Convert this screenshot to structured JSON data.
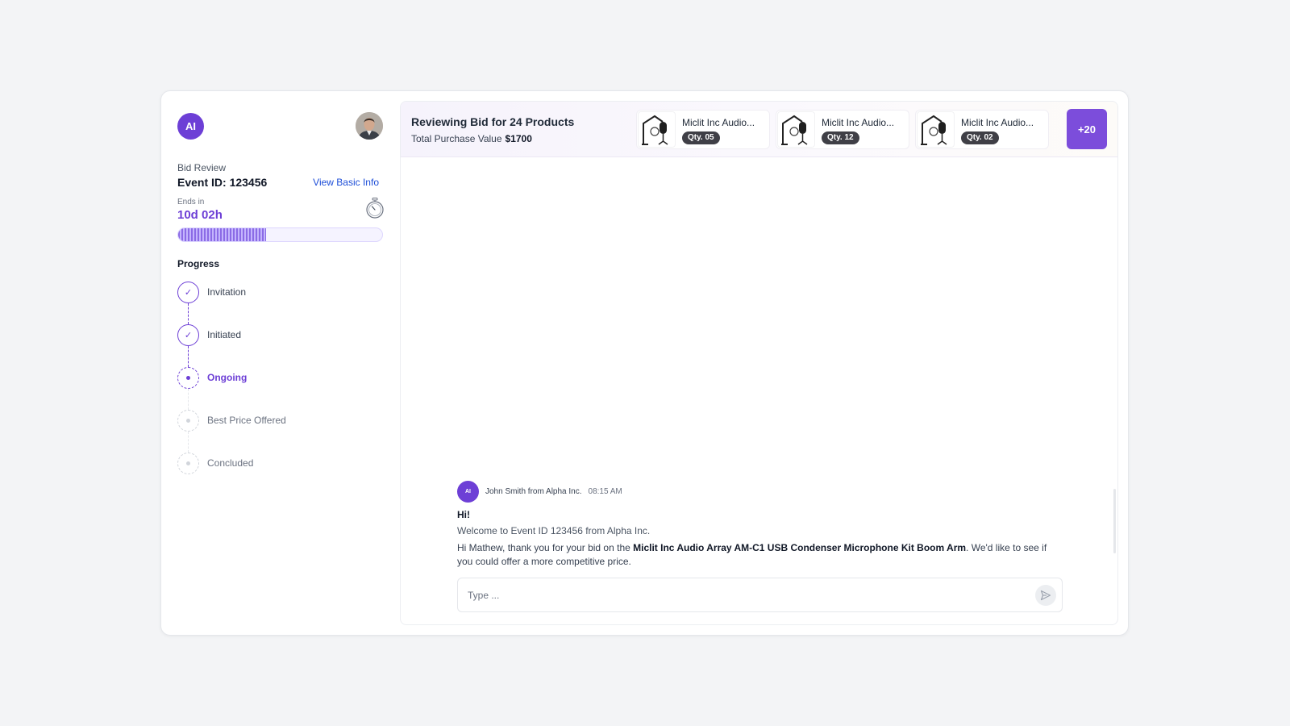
{
  "sidebar": {
    "logo_text": "AI",
    "subtitle": "Bid Review",
    "event_label": "Event ID: 123456",
    "view_link": "View Basic Info",
    "ends_label": "Ends in",
    "ends_value": "10d 02h",
    "time_progress_percent": 43,
    "progress_title": "Progress",
    "steps": [
      {
        "label": "Invitation",
        "status": "done"
      },
      {
        "label": "Initiated",
        "status": "done"
      },
      {
        "label": "Ongoing",
        "status": "current"
      },
      {
        "label": "Best Price Offered",
        "status": "pending"
      },
      {
        "label": "Concluded",
        "status": "pending"
      }
    ]
  },
  "header": {
    "title": "Reviewing Bid for 24 Products",
    "subtitle_label": "Total Purchase Value",
    "subtitle_value": "$1700",
    "products": [
      {
        "name": "Miclit Inc Audio...",
        "qty": "Qty. 05"
      },
      {
        "name": "Miclit Inc Audio...",
        "qty": "Qty. 12"
      },
      {
        "name": "Miclit Inc Audio...",
        "qty": "Qty. 02"
      }
    ],
    "more_label": "+20"
  },
  "message": {
    "avatar_text": "AI",
    "sender": "John Smith from Alpha Inc.",
    "time": "08:15 AM",
    "greeting": "Hi!",
    "welcome": "Welcome to Event ID 123456 from Alpha Inc.",
    "body_before": "Hi Mathew, thank you for your bid on the ",
    "body_product": "Miclit Inc Audio Array AM-C1 USB Condenser Microphone Kit Boom Arm",
    "body_after": ". We'd like to see if you could offer a more competitive price."
  },
  "composer": {
    "placeholder": "Type ..."
  },
  "colors": {
    "accent": "#6d3fd6",
    "link": "#1d4ed8",
    "more_button": "#7c4ddb"
  },
  "icons": [
    "stopwatch-icon",
    "check-icon",
    "microphone-icon",
    "send-icon"
  ]
}
